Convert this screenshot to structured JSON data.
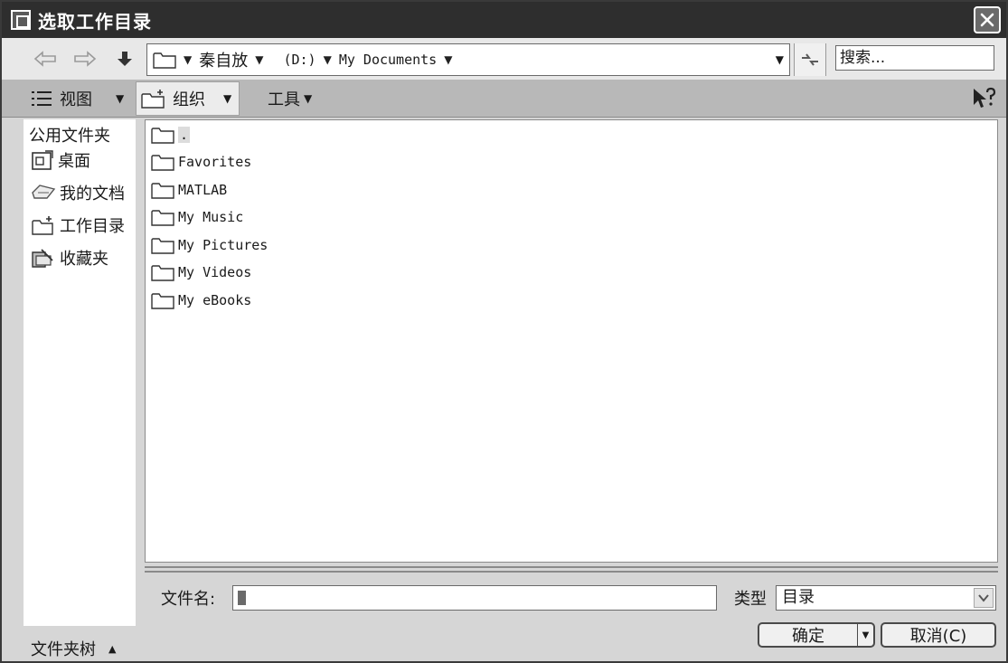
{
  "window": {
    "title": "选取工作目录"
  },
  "address": {
    "crumbs": [
      "秦自放",
      "(D:)",
      "My Documents"
    ],
    "search_placeholder": "搜索..."
  },
  "toolbar": {
    "view_label": "视图",
    "organize_label": "组织",
    "tools_label": "工具"
  },
  "sidebar": {
    "header": "公用文件夹",
    "items": [
      {
        "label": "桌面",
        "icon": "desktop-icon"
      },
      {
        "label": "我的文档",
        "icon": "documents-icon"
      },
      {
        "label": "工作目录",
        "icon": "working-dir-icon"
      },
      {
        "label": "收藏夹",
        "icon": "favorites-icon"
      }
    ],
    "tree_label": "文件夹树"
  },
  "files": [
    {
      "name": "."
    },
    {
      "name": "Favorites"
    },
    {
      "name": "MATLAB"
    },
    {
      "name": "My Music"
    },
    {
      "name": "My Pictures"
    },
    {
      "name": "My Videos"
    },
    {
      "name": "My eBooks"
    }
  ],
  "form": {
    "filename_label": "文件名:",
    "filename_value": "",
    "type_label": "类型",
    "type_value": "目录",
    "ok_label": "确定",
    "cancel_label": "取消(C)"
  }
}
